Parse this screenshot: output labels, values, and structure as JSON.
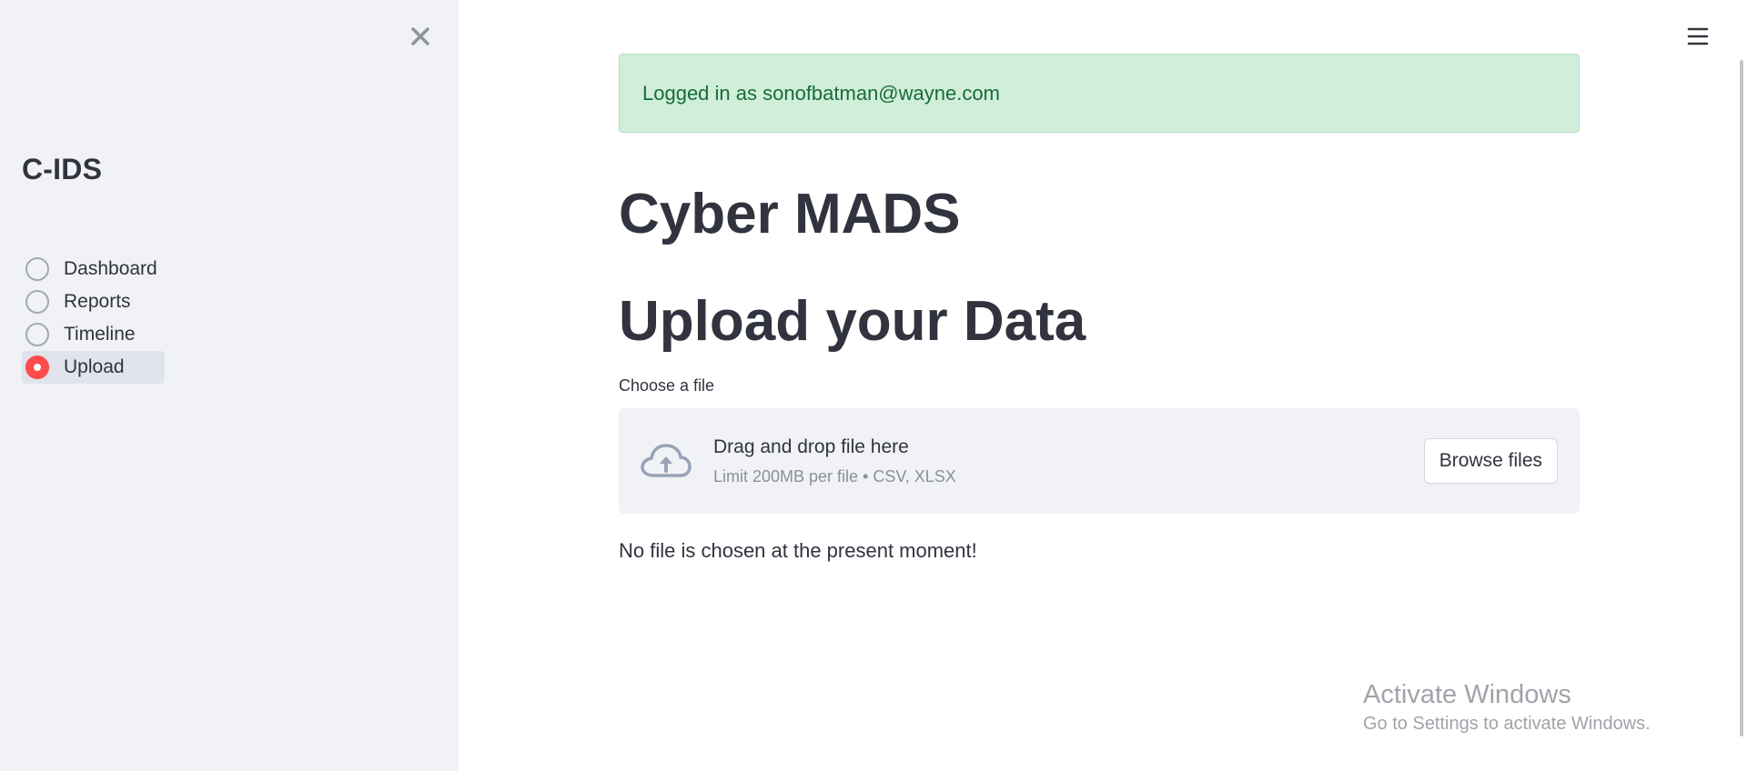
{
  "sidebar": {
    "title": "C-IDS",
    "close_icon": "close-icon",
    "items": [
      {
        "label": "Dashboard",
        "selected": false
      },
      {
        "label": "Reports",
        "selected": false
      },
      {
        "label": "Timeline",
        "selected": false
      },
      {
        "label": "Upload",
        "selected": true
      }
    ]
  },
  "header": {
    "menu_icon": "hamburger-menu-icon"
  },
  "main": {
    "alert": "Logged in as sonofbatman@wayne.com",
    "title": "Cyber MADS",
    "section_title": "Upload your Data",
    "uploader": {
      "label": "Choose a file",
      "icon": "cloud-upload-icon",
      "drop_text": "Drag and drop file here",
      "limit_text": "Limit 200MB per file • CSV, XLSX",
      "button_label": "Browse files"
    },
    "status": "No file is chosen at the present moment!"
  },
  "watermark": {
    "title": "Activate Windows",
    "subtitle": "Go to Settings to activate Windows."
  },
  "colors": {
    "sidebar_bg": "#f0f2f6",
    "accent": "#ff4b4b",
    "success_bg": "#d0eed9",
    "success_text": "#176c37",
    "text": "#31333f"
  }
}
